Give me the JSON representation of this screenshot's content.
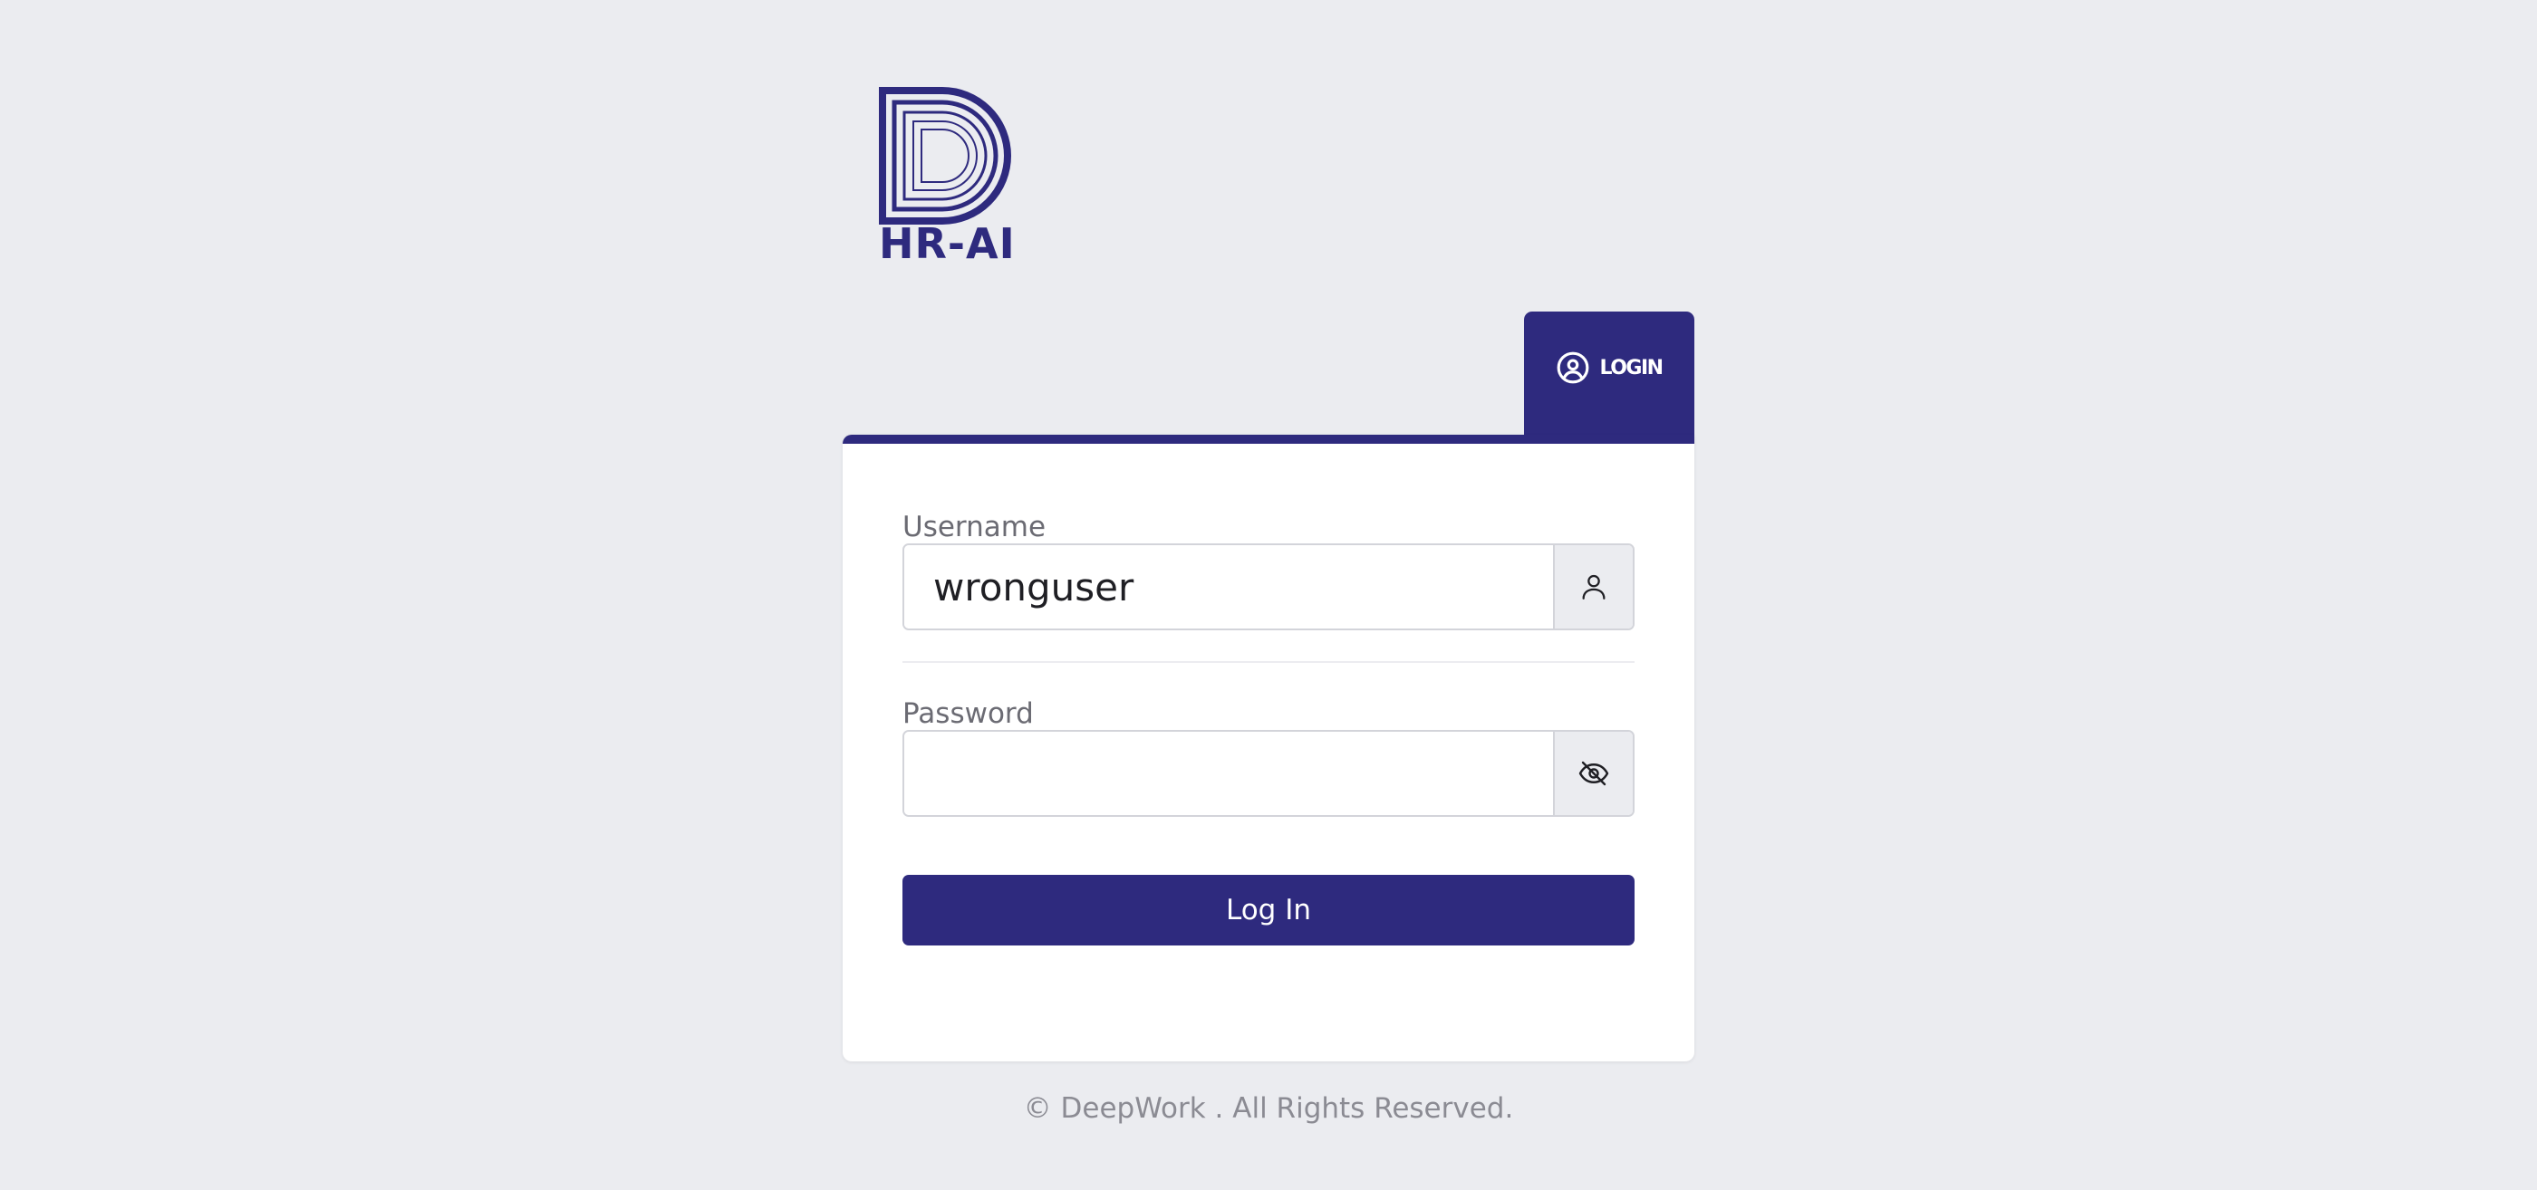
{
  "logo": {
    "text": "HR-AI",
    "icon": "hr-ai-d-logo",
    "color": "#2e2a7e"
  },
  "tab": {
    "label": "LOGIN",
    "icon": "user-circle-icon"
  },
  "form": {
    "username": {
      "label": "Username",
      "value": "wronguser",
      "icon": "user-icon"
    },
    "password": {
      "label": "Password",
      "value": "",
      "icon": "eye-off-icon"
    },
    "submit_label": "Log In"
  },
  "footer": {
    "text": "© DeepWork . All Rights Reserved."
  },
  "colors": {
    "brand": "#2e2a7e",
    "background": "#ebecf0",
    "card": "#ffffff"
  }
}
